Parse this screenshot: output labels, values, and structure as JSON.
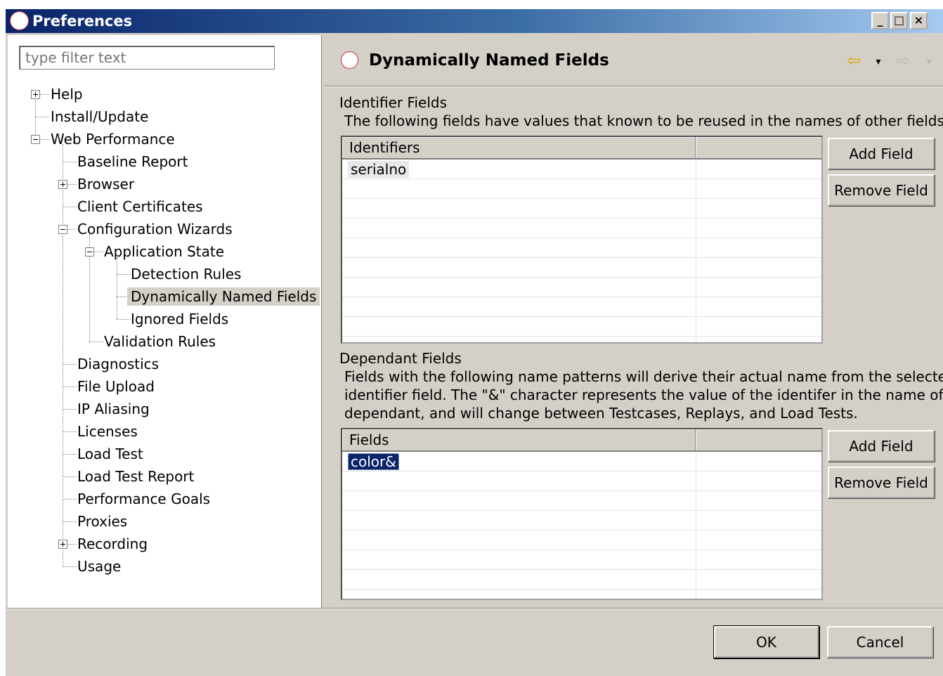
{
  "window": {
    "title": "Preferences",
    "minimize": "_",
    "maximize": "□",
    "close": "×"
  },
  "filter": {
    "placeholder": "type filter text"
  },
  "tree": {
    "help": "Help",
    "install_update": "Install/Update",
    "web_performance": "Web Performance",
    "baseline_report": "Baseline Report",
    "browser": "Browser",
    "client_certificates": "Client Certificates",
    "configuration_wizards": "Configuration Wizards",
    "application_state": "Application State",
    "detection_rules": "Detection Rules",
    "dynamically_named_fields": "Dynamically Named Fields",
    "ignored_fields": "Ignored Fields",
    "validation_rules": "Validation Rules",
    "diagnostics": "Diagnostics",
    "file_upload": "File Upload",
    "ip_aliasing": "IP Aliasing",
    "licenses": "Licenses",
    "load_test": "Load Test",
    "load_test_report": "Load Test Report",
    "performance_goals": "Performance Goals",
    "proxies": "Proxies",
    "recording": "Recording",
    "usage": "Usage"
  },
  "page": {
    "title": "Dynamically Named Fields",
    "back_icon": "back-arrow",
    "forward_icon": "forward-arrow"
  },
  "identifier_section": {
    "heading": "Identifier Fields",
    "description": "The following fields have values that known to be reused in the names of other fields.",
    "column": "Identifiers",
    "rows": [
      "serialno"
    ],
    "add_label": "Add Field",
    "remove_label": "Remove Field"
  },
  "dependant_section": {
    "heading": "Dependant Fields",
    "description_1": "Fields with the following name patterns will derive their actual name from the selected",
    "description_2": "identifier field. The \"&\" character represents the value of the identifer in the name of the",
    "description_3": "dependant, and will change between Testcases, Replays, and Load Tests.",
    "column": "Fields",
    "rows": [
      "color&"
    ],
    "add_label": "Add Field",
    "remove_label": "Remove Field"
  },
  "footer": {
    "ok_label": "OK",
    "cancel_label": "Cancel"
  }
}
